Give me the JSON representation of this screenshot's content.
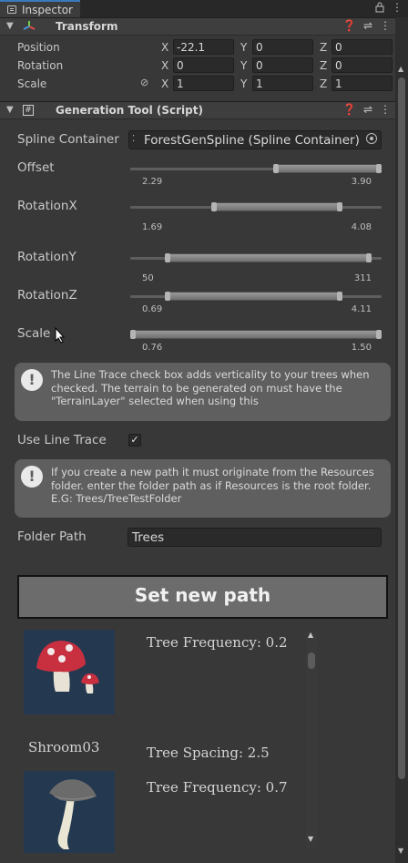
{
  "window": {
    "tab_label": "Inspector"
  },
  "transform": {
    "title": "Transform",
    "rows": [
      {
        "label": "Position",
        "x": "-22.1",
        "y": "0",
        "z": "0"
      },
      {
        "label": "Rotation",
        "x": "0",
        "y": "0",
        "z": "0"
      },
      {
        "label": "Scale",
        "x": "1",
        "y": "1",
        "z": "1"
      }
    ],
    "axes": {
      "x": "X",
      "y": "Y",
      "z": "Z"
    }
  },
  "generation_tool": {
    "title": "Generation Tool (Script)",
    "spline_container": {
      "label": "Spline Container",
      "value": "ForestGenSpline (Spline Container)"
    },
    "sliders": [
      {
        "label": "Offset",
        "min": "2.29",
        "max": "3.90",
        "range_start": 0.58,
        "range_end": 1.0
      },
      {
        "label": "RotationX",
        "min": "1.69",
        "max": "4.08",
        "range_start": 0.33,
        "range_end": 0.84
      },
      {
        "label": "RotationY",
        "min": "50",
        "max": "311",
        "range_start": 0.14,
        "range_end": 0.96
      },
      {
        "label": "RotationZ",
        "min": "0.69",
        "max": "4.11",
        "range_start": 0.14,
        "range_end": 0.84
      },
      {
        "label": "Scale",
        "min": "0.76",
        "max": "1.50",
        "range_start": 0.0,
        "range_end": 1.0
      }
    ],
    "help_line_trace": "The Line Trace check box adds verticality to your trees when checked. The terrain to be generated on must have the \"TerrainLayer\" selected when using this",
    "use_line_trace": {
      "label": "Use Line Trace",
      "checked": true,
      "check_glyph": "✓"
    },
    "help_path": "If you create a new path it must originate from the Resources folder. enter the folder path as if Resources is the root folder. E.G: Trees/TreeTestFolder",
    "folder_path": {
      "label": "Folder Path",
      "value": "Trees"
    },
    "set_path_button": "Set new path",
    "trees": [
      {
        "name": "Shroom03",
        "frequency": "Tree Frequency: 0.2",
        "spacing": "Tree Spacing: 2.5",
        "icon": "mushroom-red-icon"
      },
      {
        "name": "",
        "frequency": "Tree Frequency: 0.7",
        "icon": "mushroom-white-icon"
      }
    ]
  },
  "colors": {
    "accent_tab": "#3a79bb",
    "help_bg": "#5f5f5f",
    "thumb_bg": "#243950"
  }
}
